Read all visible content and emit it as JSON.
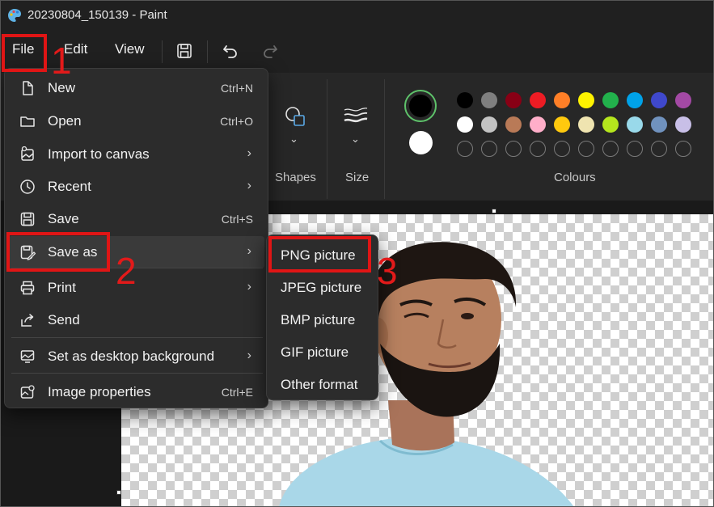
{
  "window": {
    "title": "20230804_150139 - Paint"
  },
  "menubar": {
    "file": "File",
    "edit": "Edit",
    "view": "View",
    "save_icon": "save-icon",
    "undo_icon": "undo-icon",
    "redo_icon": "redo-icon"
  },
  "ribbon": {
    "shapes_label": "Shapes",
    "size_label": "Size",
    "colours_label": "Colours",
    "primary_colour": "#000000",
    "secondary_colour": "#ffffff",
    "palette_row1": [
      "#000000",
      "#7f7f7f",
      "#880015",
      "#ed1c24",
      "#ff7f27",
      "#fff200",
      "#22b14c",
      "#00a2e8",
      "#3f48cc",
      "#a349a4"
    ],
    "palette_row2": [
      "#ffffff",
      "#c3c3c3",
      "#b97a57",
      "#ffaec9",
      "#ffc90e",
      "#efe4b0",
      "#b5e61d",
      "#99d9ea",
      "#7092be",
      "#c8bfe7"
    ]
  },
  "file_menu": {
    "items": [
      {
        "label": "New",
        "shortcut": "Ctrl+N",
        "icon": "new-file-icon"
      },
      {
        "label": "Open",
        "shortcut": "Ctrl+O",
        "icon": "folder-icon"
      },
      {
        "label": "Import to canvas",
        "submenu": true,
        "icon": "import-image-icon"
      },
      {
        "label": "Recent",
        "submenu": true,
        "icon": "clock-icon"
      },
      {
        "label": "Save",
        "shortcut": "Ctrl+S",
        "icon": "save-icon"
      },
      {
        "label": "Save as",
        "submenu": true,
        "icon": "save-as-icon",
        "active": true
      },
      {
        "label": "Print",
        "submenu": true,
        "icon": "printer-icon"
      },
      {
        "label": "Send",
        "icon": "share-icon"
      },
      {
        "label": "Set as desktop background",
        "submenu": true,
        "icon": "desktop-background-icon"
      },
      {
        "label": "Image properties",
        "shortcut": "Ctrl+E",
        "icon": "image-properties-icon"
      }
    ]
  },
  "save_as_submenu": {
    "items": [
      {
        "label": "PNG picture"
      },
      {
        "label": "JPEG picture"
      },
      {
        "label": "BMP picture"
      },
      {
        "label": "GIF picture"
      },
      {
        "label": "Other format"
      }
    ]
  },
  "annotations": {
    "step1": "1",
    "step2": "2",
    "step3": "3",
    "color": "#e01515"
  }
}
